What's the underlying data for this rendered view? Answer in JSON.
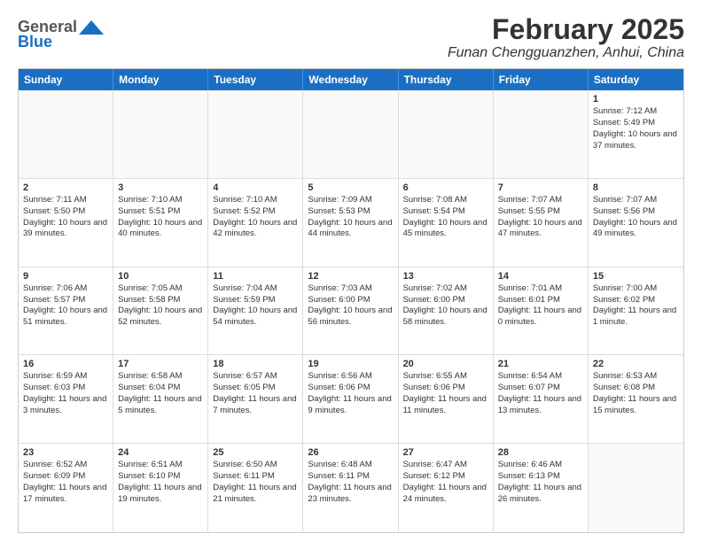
{
  "header": {
    "logo_general": "General",
    "logo_blue": "Blue",
    "month": "February 2025",
    "location": "Funan Chengguanzhen, Anhui, China"
  },
  "weekdays": [
    "Sunday",
    "Monday",
    "Tuesday",
    "Wednesday",
    "Thursday",
    "Friday",
    "Saturday"
  ],
  "weeks": [
    [
      {
        "day": "",
        "info": ""
      },
      {
        "day": "",
        "info": ""
      },
      {
        "day": "",
        "info": ""
      },
      {
        "day": "",
        "info": ""
      },
      {
        "day": "",
        "info": ""
      },
      {
        "day": "",
        "info": ""
      },
      {
        "day": "1",
        "info": "Sunrise: 7:12 AM\nSunset: 5:49 PM\nDaylight: 10 hours\nand 37 minutes."
      }
    ],
    [
      {
        "day": "2",
        "info": "Sunrise: 7:11 AM\nSunset: 5:50 PM\nDaylight: 10 hours\nand 39 minutes."
      },
      {
        "day": "3",
        "info": "Sunrise: 7:10 AM\nSunset: 5:51 PM\nDaylight: 10 hours\nand 40 minutes."
      },
      {
        "day": "4",
        "info": "Sunrise: 7:10 AM\nSunset: 5:52 PM\nDaylight: 10 hours\nand 42 minutes."
      },
      {
        "day": "5",
        "info": "Sunrise: 7:09 AM\nSunset: 5:53 PM\nDaylight: 10 hours\nand 44 minutes."
      },
      {
        "day": "6",
        "info": "Sunrise: 7:08 AM\nSunset: 5:54 PM\nDaylight: 10 hours\nand 45 minutes."
      },
      {
        "day": "7",
        "info": "Sunrise: 7:07 AM\nSunset: 5:55 PM\nDaylight: 10 hours\nand 47 minutes."
      },
      {
        "day": "8",
        "info": "Sunrise: 7:07 AM\nSunset: 5:56 PM\nDaylight: 10 hours\nand 49 minutes."
      }
    ],
    [
      {
        "day": "9",
        "info": "Sunrise: 7:06 AM\nSunset: 5:57 PM\nDaylight: 10 hours\nand 51 minutes."
      },
      {
        "day": "10",
        "info": "Sunrise: 7:05 AM\nSunset: 5:58 PM\nDaylight: 10 hours\nand 52 minutes."
      },
      {
        "day": "11",
        "info": "Sunrise: 7:04 AM\nSunset: 5:59 PM\nDaylight: 10 hours\nand 54 minutes."
      },
      {
        "day": "12",
        "info": "Sunrise: 7:03 AM\nSunset: 6:00 PM\nDaylight: 10 hours\nand 56 minutes."
      },
      {
        "day": "13",
        "info": "Sunrise: 7:02 AM\nSunset: 6:00 PM\nDaylight: 10 hours\nand 58 minutes."
      },
      {
        "day": "14",
        "info": "Sunrise: 7:01 AM\nSunset: 6:01 PM\nDaylight: 11 hours\nand 0 minutes."
      },
      {
        "day": "15",
        "info": "Sunrise: 7:00 AM\nSunset: 6:02 PM\nDaylight: 11 hours\nand 1 minute."
      }
    ],
    [
      {
        "day": "16",
        "info": "Sunrise: 6:59 AM\nSunset: 6:03 PM\nDaylight: 11 hours\nand 3 minutes."
      },
      {
        "day": "17",
        "info": "Sunrise: 6:58 AM\nSunset: 6:04 PM\nDaylight: 11 hours\nand 5 minutes."
      },
      {
        "day": "18",
        "info": "Sunrise: 6:57 AM\nSunset: 6:05 PM\nDaylight: 11 hours\nand 7 minutes."
      },
      {
        "day": "19",
        "info": "Sunrise: 6:56 AM\nSunset: 6:06 PM\nDaylight: 11 hours\nand 9 minutes."
      },
      {
        "day": "20",
        "info": "Sunrise: 6:55 AM\nSunset: 6:06 PM\nDaylight: 11 hours\nand 11 minutes."
      },
      {
        "day": "21",
        "info": "Sunrise: 6:54 AM\nSunset: 6:07 PM\nDaylight: 11 hours\nand 13 minutes."
      },
      {
        "day": "22",
        "info": "Sunrise: 6:53 AM\nSunset: 6:08 PM\nDaylight: 11 hours\nand 15 minutes."
      }
    ],
    [
      {
        "day": "23",
        "info": "Sunrise: 6:52 AM\nSunset: 6:09 PM\nDaylight: 11 hours\nand 17 minutes."
      },
      {
        "day": "24",
        "info": "Sunrise: 6:51 AM\nSunset: 6:10 PM\nDaylight: 11 hours\nand 19 minutes."
      },
      {
        "day": "25",
        "info": "Sunrise: 6:50 AM\nSunset: 6:11 PM\nDaylight: 11 hours\nand 21 minutes."
      },
      {
        "day": "26",
        "info": "Sunrise: 6:48 AM\nSunset: 6:11 PM\nDaylight: 11 hours\nand 23 minutes."
      },
      {
        "day": "27",
        "info": "Sunrise: 6:47 AM\nSunset: 6:12 PM\nDaylight: 11 hours\nand 24 minutes."
      },
      {
        "day": "28",
        "info": "Sunrise: 6:46 AM\nSunset: 6:13 PM\nDaylight: 11 hours\nand 26 minutes."
      },
      {
        "day": "",
        "info": ""
      }
    ]
  ]
}
